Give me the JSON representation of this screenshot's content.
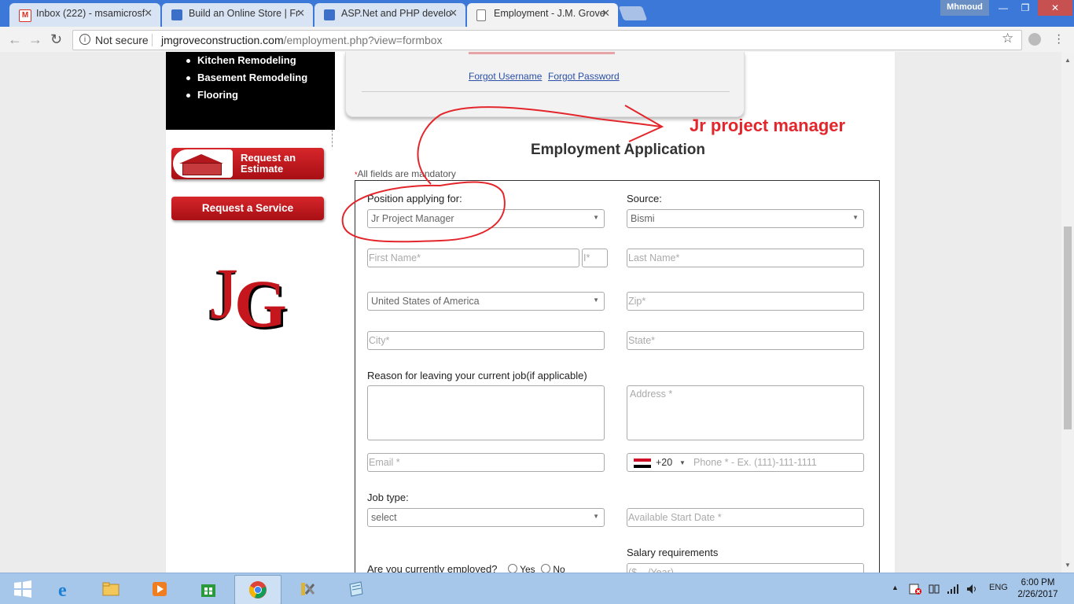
{
  "browser": {
    "tabs": [
      {
        "title": "Inbox (222) - msamicrosf",
        "icon_color": "#d93025",
        "icon": "gmail-icon"
      },
      {
        "title": "Build an Online Store | Fr",
        "icon_color": "#3c6fc8",
        "icon": "site-icon"
      },
      {
        "title": "ASP.Net and PHP develo",
        "icon_color": "#3c6fc8",
        "icon": "site-icon"
      },
      {
        "title": "Employment - J.M. Grove",
        "icon_color": "#777777",
        "icon": "document-icon"
      }
    ],
    "close_glyph": "✕",
    "user": "Mhmoud",
    "security": "Not secure",
    "url_host": "jmgroveconstruction.com",
    "url_path": "/employment.php?view=formbox"
  },
  "sidebar": {
    "menu_items": [
      "Kitchen Remodeling",
      "Basement Remodeling",
      "Flooring"
    ],
    "request_estimate": "Request an Estimate",
    "request_service": "Request a Service",
    "logo_letters": "JG"
  },
  "login": {
    "forgot_username": "Forgot Username",
    "forgot_password": "Forgot Password"
  },
  "form": {
    "title": "Employment Application",
    "mandatory_note": "All fields are mandatory",
    "position_label": "Position applying for:",
    "position_value": "Jr Project Manager",
    "source_label": "Source:",
    "source_value": "Bismi",
    "first_name_ph": "First Name*",
    "initial_ph": "I*",
    "last_name_ph": "Last Name*",
    "country_value": "United States of America",
    "zip_ph": "Zip*",
    "city_ph": "City*",
    "state_ph": "State*",
    "reason_label": "Reason for leaving your current job(if applicable)",
    "address_ph": "Address *",
    "email_ph": "Email *",
    "dial_code": "+20",
    "phone_ph": "Phone * - Ex. (111)-111-1111",
    "job_type_label": "Job type:",
    "job_type_value": "select",
    "start_date_ph": "Available Start Date *",
    "salary_label": "Salary requirements",
    "salary_ph": "($ .../Year)",
    "employed_label": "Are you currently employed?",
    "yes": "Yes",
    "no": "No"
  },
  "annotation": {
    "text": "Jr project manager",
    "color": "#e3262b"
  },
  "taskbar": {
    "language": "ENG",
    "time": "6:00 PM",
    "date": "2/26/2017",
    "apps": [
      "start-button",
      "internet-explorer-icon",
      "file-explorer-icon",
      "media-player-icon",
      "windows-store-icon",
      "chrome-icon",
      "tools-icon",
      "notepad-icon"
    ]
  }
}
